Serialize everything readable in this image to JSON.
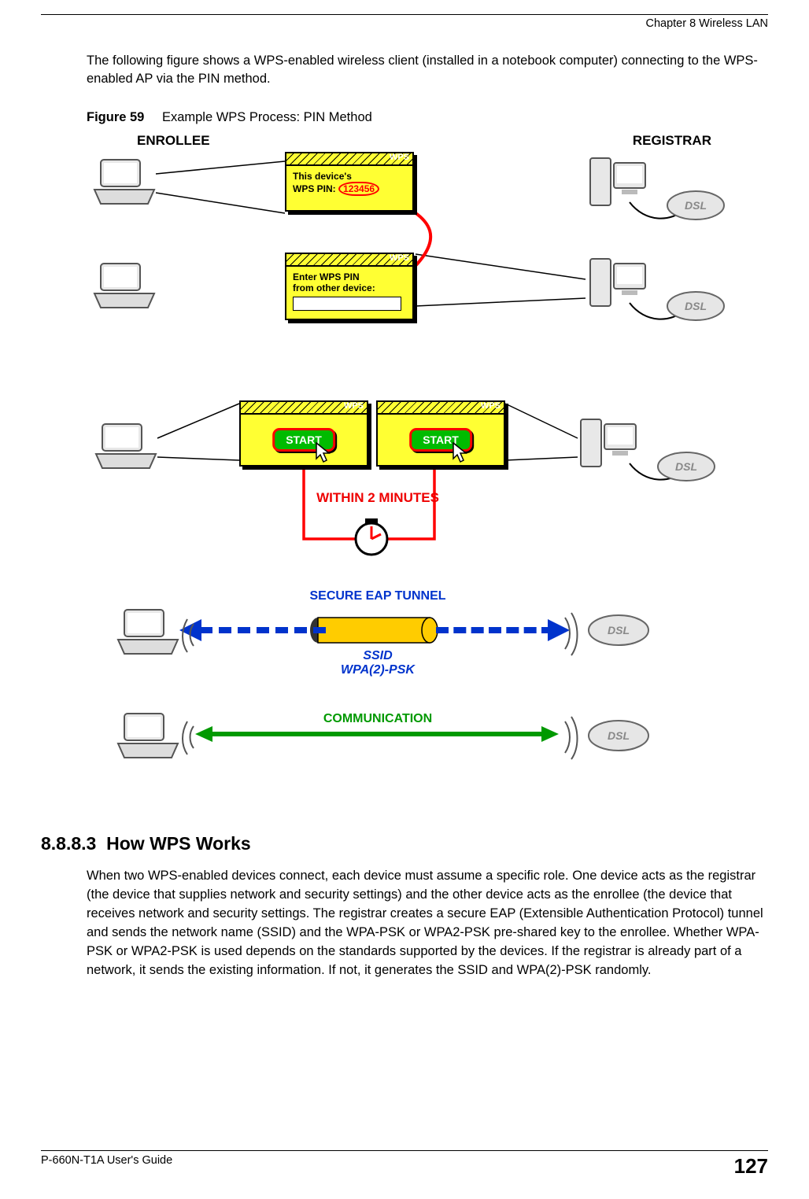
{
  "header": {
    "chapter": "Chapter 8 Wireless LAN"
  },
  "intro_paragraph": "The following figure shows a WPS-enabled wireless client (installed in a notebook computer) connecting to the WPS-enabled AP via the PIN method.",
  "figure": {
    "label": "Figure 59",
    "caption": "Example WPS Process: PIN Method",
    "enrollee_label": "ENROLLEE",
    "registrar_label": "REGISTRAR",
    "wps_tag": "WPS",
    "window_pin": {
      "line1": "This device's",
      "line2_prefix": "WPS PIN: ",
      "pin": "123456"
    },
    "window_enter": {
      "line1": "Enter WPS PIN",
      "line2": "from other device:"
    },
    "start_label": "START",
    "within_two_minutes": "WITHIN 2 MINUTES",
    "secure_tunnel": "SECURE EAP TUNNEL",
    "ssid": "SSID",
    "wpa": "WPA(2)-PSK",
    "communication": "COMMUNICATION"
  },
  "section": {
    "number": "8.8.8.3",
    "title": "How WPS Works",
    "paragraph": "When two WPS-enabled devices connect, each device must assume a specific role. One device acts as the registrar (the device that supplies network and security settings) and the other device acts as the enrollee (the device that receives network and security settings. The registrar creates a secure EAP (Extensible Authentication Protocol) tunnel and sends the network name (SSID) and the WPA-PSK or WPA2-PSK pre-shared key to the enrollee. Whether WPA-PSK or WPA2-PSK is used depends on the standards supported by the devices. If the registrar is already part of a network, it sends the existing information. If not, it generates the SSID and WPA(2)-PSK randomly."
  },
  "footer": {
    "guide": "P-660N-T1A User's Guide",
    "page": "127"
  }
}
